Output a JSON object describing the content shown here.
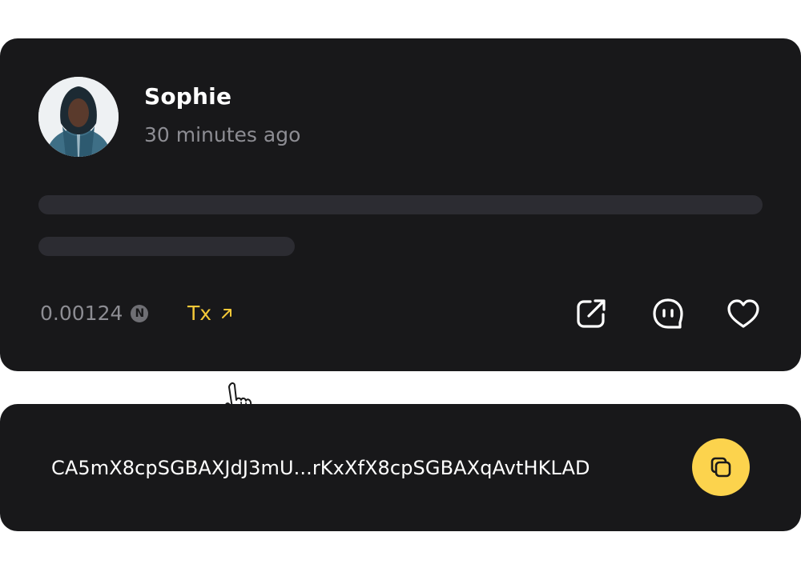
{
  "post": {
    "author": "Sophie",
    "time": "30 minutes ago",
    "amount": "0.00124",
    "token_symbol": "N",
    "tx_label": "Tx",
    "icons": {
      "avatar": "avatar-photo",
      "token": "token-icon",
      "tx": "arrow-up-right-icon",
      "share": "share-icon",
      "comment": "comment-icon",
      "like": "heart-icon",
      "cursor": "hand-pointer-icon"
    }
  },
  "address": {
    "value": "CA5mX8cpSGBAXJdJ3mU...rKxXfX8cpSGBAXqAvtHKLAD",
    "copy_icon": "copy-icon"
  },
  "colors": {
    "card_bg": "#18181a",
    "skeleton": "#2c2c32",
    "muted_text": "#8d8d93",
    "accent": "#f4c838",
    "copy_button": "#fcd34d"
  }
}
